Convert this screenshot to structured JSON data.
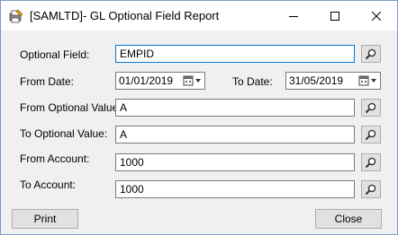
{
  "window": {
    "title": "[SAMLTD]- GL Optional Field Report",
    "icon": "report-icon"
  },
  "form": {
    "optional_field": {
      "label": "Optional Field:",
      "value": "EMPID"
    },
    "from_date": {
      "label": "From Date:",
      "value": "01/01/2019"
    },
    "to_date": {
      "label": "To Date:",
      "value": "31/05/2019"
    },
    "from_optional_value": {
      "label": "From Optional Value:",
      "value": "A"
    },
    "to_optional_value": {
      "label": "To Optional Value:",
      "value": "A"
    },
    "from_account": {
      "label": "From Account:",
      "value": "1000"
    },
    "to_account": {
      "label": "To Account:",
      "value": "1000"
    }
  },
  "buttons": {
    "print": "Print",
    "close": "Close"
  },
  "colors": {
    "focus_border": "#0078d7",
    "dialog_bg": "#f0f0f0"
  }
}
